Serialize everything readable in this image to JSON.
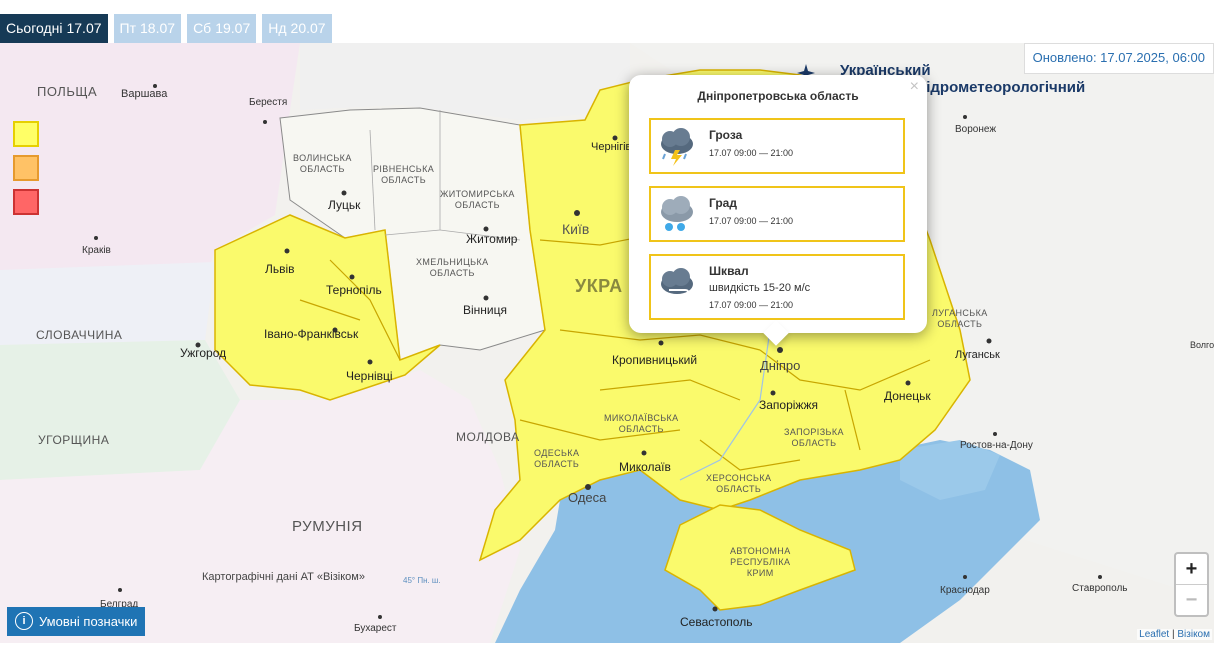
{
  "tabs": [
    {
      "day": "Сьогодні",
      "date": "17.07",
      "active": true
    },
    {
      "day": "Пт",
      "date": "18.07",
      "active": false
    },
    {
      "day": "Сб",
      "date": "19.07",
      "active": false
    },
    {
      "day": "Нд",
      "date": "20.07",
      "active": false
    }
  ],
  "updated": "Оновлено: 17.07.2025, 06:00",
  "logo": {
    "line1": "Український",
    "line2": "гідрометеорологічний"
  },
  "legend_colors": [
    "#ffff66",
    "#ffc266",
    "#ff6666"
  ],
  "popup": {
    "title": "Дніпропетровська область",
    "close": "×",
    "warnings": [
      {
        "icon": "thunderstorm-icon",
        "title": "Гроза",
        "sub": "",
        "time": "17.07 09:00 — 21:00"
      },
      {
        "icon": "hail-icon",
        "title": "Град",
        "sub": "",
        "time": "17.07 09:00 — 21:00"
      },
      {
        "icon": "squall-icon",
        "title": "Шквал",
        "sub": "швидкість 15-20 м/с",
        "time": "17.07 09:00 — 21:00"
      }
    ]
  },
  "map": {
    "countries": {
      "poland": "ПОЛЬЩА",
      "slovakia": "СЛОВАЧЧИНА",
      "hungary": "УГОРЩИНА",
      "romania": "РУМУНІЯ",
      "moldova": "МОЛДОВА",
      "ukraine": "УКРА"
    },
    "oblasts": {
      "volyn": "ВОЛИНСЬКА\nОБЛАСТЬ",
      "rivne": "РІВНЕНСЬКА\nОБЛАСТЬ",
      "zhytomyr": "ЖИТОМИРСЬКА\nОБЛАСТЬ",
      "khmelnytskyi": "ХМЕЛЬНИЦЬКА\nОБЛАСТЬ",
      "mykolaiv": "МИКОЛАЇВСЬКА\nОБЛАСТЬ",
      "odesa": "ОДЕСЬКА\nОБЛАСТЬ",
      "kherson": "ХЕРСОНСЬКА\nОБЛАСТЬ",
      "zaporizhzhia": "ЗАПОРІЗЬКА\nОБЛАСТЬ",
      "luhansk": "ЛУГАНСЬКА\nОБЛАСТЬ",
      "crimea": "АВТОНОМНА\nРЕСПУБЛІКА\nКРИМ"
    },
    "cities": {
      "lutsk": "Луцьк",
      "zhytomyr": "Житомир",
      "kyiv": "Київ",
      "lviv": "Львів",
      "ternopil": "Тернопіль",
      "ivano": "Івано-Франківськ",
      "uzhhorod": "Ужгород",
      "chernivtsi": "Чернівці",
      "vinnytsia": "Вінниця",
      "kropyvnytskyi": "Кропивницький",
      "dnipro": "Дніпро",
      "zaporizhzhia": "Запоріжжя",
      "donetsk": "Донецьк",
      "luhansk": "Луганськ",
      "mykolaiv": "Миколаїв",
      "odesa": "Одеса",
      "sevastopol": "Севастополь",
      "chernihiv": "Чернігів"
    },
    "foreign": {
      "warsaw": "Варшава",
      "brest": "Берестя",
      "voronezh": "Воронеж",
      "krakow": "Краків",
      "rostov": "Ростов-на-Дону",
      "krasnodar": "Краснодар",
      "stavropol": "Ставрополь",
      "belgrade": "Белград",
      "bucharest": "Бухарест",
      "volgo": "Волго"
    },
    "carto": "Картографічні дані АТ «Візіком»",
    "lat_label": "45° Пн. ш."
  },
  "controls": {
    "zoom_in": "+",
    "zoom_out": "−",
    "legend_button": "Умовні позначки",
    "info": "i"
  },
  "attribution": {
    "leaflet": "Leaflet",
    "sep": "|",
    "vizicom": "Візіком"
  }
}
